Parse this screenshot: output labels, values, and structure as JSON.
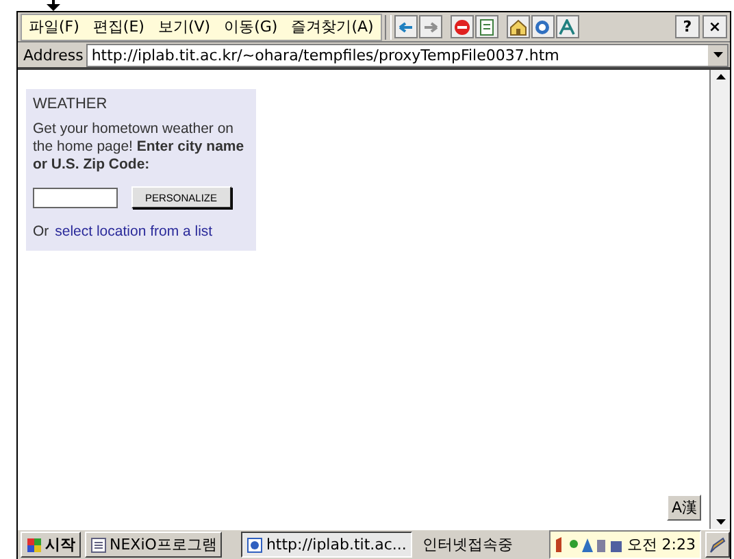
{
  "menu": [
    {
      "label": "파일(F)"
    },
    {
      "label": "편집(E)"
    },
    {
      "label": "보기(V)"
    },
    {
      "label": "이동(G)"
    },
    {
      "label": "즐겨찾기(A)"
    }
  ],
  "help": "?",
  "close": "×",
  "address": {
    "label": "Address",
    "value": "http://iplab.tit.ac.kr/~ohara/tempfiles/proxyTempFile0037.htm"
  },
  "weather": {
    "title": "WEATHER",
    "text": "Get your hometown weather on the home page! **Enter city name or U.S. Zip Code:**",
    "button": "PERSONALIZE",
    "footer_prefix": "Or",
    "link": "select location from a list"
  },
  "ime_button": "A漢",
  "taskbar": {
    "start": "시작",
    "items": [
      {
        "label": "NEXiO프로그램",
        "selected": false
      },
      {
        "label": "http://iplab.tit.ac...",
        "selected": true
      }
    ],
    "status": "인터넷접속중",
    "clock": "오전 2:23"
  }
}
